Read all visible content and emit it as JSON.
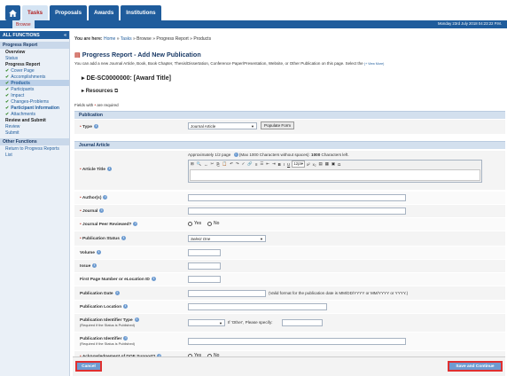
{
  "nav": {
    "tabs": [
      "Tasks",
      "Proposals",
      "Awards",
      "Institutions"
    ],
    "sub_tab": "Browse",
    "date": "Monday 23rd July 2018 04:23:22 P.M."
  },
  "sidebar": {
    "header": "ALL FUNCTIONS",
    "sections": [
      {
        "title": "Progress Report",
        "items": [
          "Overview",
          "Status",
          "Progress Report",
          "Cover Page",
          "Accomplishments",
          "Products",
          "Participants",
          "Impact",
          "Changes-Problems",
          "Participant Information",
          "Attachments",
          "Review and Submit",
          "Review",
          "Submit"
        ]
      },
      {
        "title": "Other Functions",
        "items": [
          "Return to Progress Reports",
          "List"
        ]
      }
    ]
  },
  "breadcrumb": {
    "prefix": "You are here:",
    "home": "Home",
    "tasks": "Tasks",
    "rest": "» Browse » Progress Report » Products"
  },
  "page": {
    "title": "Progress Report - Add New Publication",
    "description": "You can add a new Journal Article, Book, Book Chapter, Thesis/Dissertation, Conference Paper/Presentation, Website, or Other Publication on this page. Select the",
    "view_more": "(+ View More)",
    "award": "DE-SC0000000: [Award Title]",
    "resources": "Resources",
    "required_pre": "Fields with",
    "required_post": "are required"
  },
  "publication": {
    "section": "Publication",
    "type_label": "Type",
    "type_value": "Journal Article",
    "populate": "Populate Form"
  },
  "journal": {
    "section": "Journal Article",
    "article_title_label": "Article Title",
    "editor_hint_a": "Approximately 1/2 page",
    "editor_hint_b": "(Max 1000 Characters without spaces):",
    "editor_hint_c": "1000",
    "editor_hint_d": "Characters left.",
    "authors_label": "Author(s)",
    "journal_label": "Journal",
    "peer_label": "Journal Peer Reviewed?",
    "yes": "Yes",
    "no": "No",
    "status_label": "Publication Status",
    "status_value": "Select One",
    "volume_label": "Volume",
    "issue_label": "Issue",
    "first_page_label": "First Page Number or eLocation ID",
    "date_label": "Publication Date",
    "date_hint": "(Valid format for the publication date is MM/DD/YYYY or MM/YYYY or YYYY.)",
    "location_label": "Publication Location",
    "id_type_label": "Publication Identifier Type",
    "id_type_sub": "(Required if the Status is Published)",
    "other_specify": "If 'Other', Please specify:",
    "identifier_label": "Publication Identifier",
    "identifier_sub": "(Required if the Status is Published)",
    "ack_label": "Acknowledgement of DOE Support?"
  },
  "footer": {
    "cancel": "Cancel",
    "save": "Save and Continue"
  }
}
